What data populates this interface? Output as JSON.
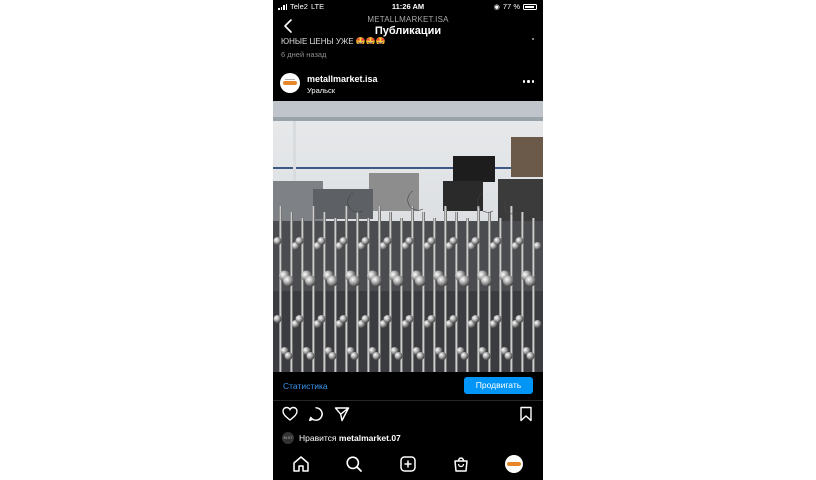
{
  "status_bar": {
    "carrier": "Tele2",
    "network": "LTE",
    "time": "11:26 AM",
    "battery": "77 %"
  },
  "header": {
    "subtitle": "METALLMARKET.ISA",
    "title": "Публикации"
  },
  "previous_post": {
    "caption_fragment": "ЮНЫЕ ЦЕНЫ УЖЕ 🤩🤩🤩",
    "time_ago": "6 дней назад"
  },
  "post": {
    "username": "metallmarket.isa",
    "location": "Уральск",
    "image_description_icon": "stainless-steel-railing-parts-photo",
    "statistics_link": "Статистика",
    "promote_button": "Продвигать",
    "likes_prefix": "Нравится",
    "liked_by": "metalmarket.07",
    "liker_avatar_text": "M.07"
  },
  "tabbar": {
    "items": [
      "home-icon",
      "search-icon",
      "add-icon",
      "shop-icon",
      "profile-avatar"
    ]
  },
  "colors": {
    "accent": "#0095f6",
    "link": "#3897f0",
    "brand_orange": "#e8862a",
    "background": "#000000"
  }
}
